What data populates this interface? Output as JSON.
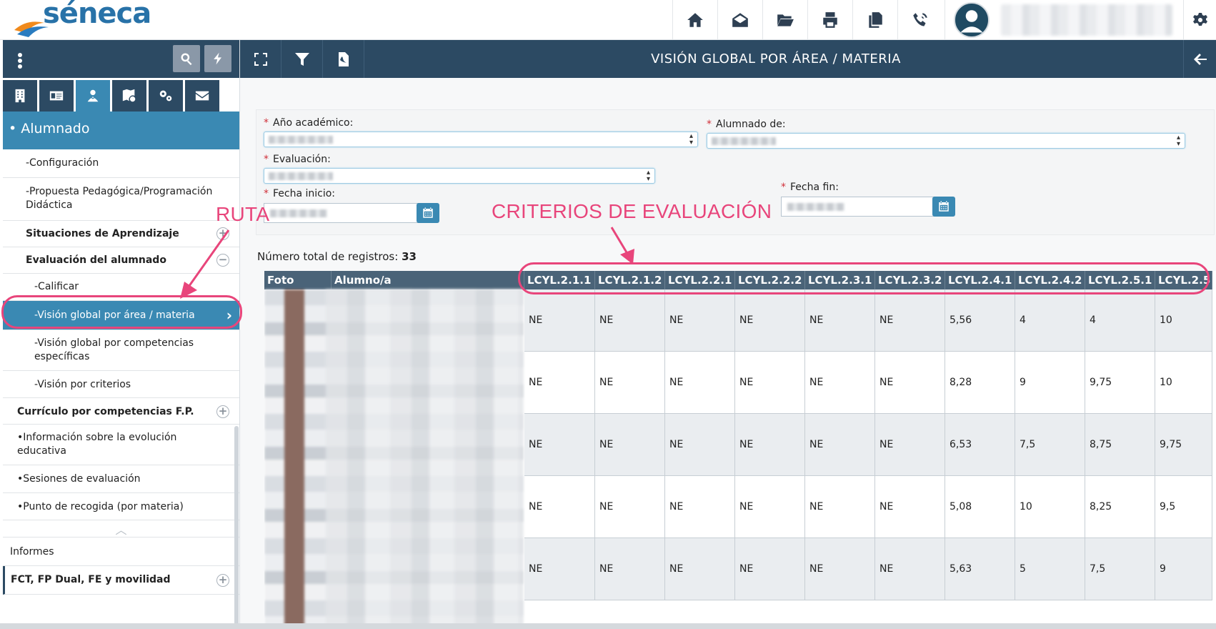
{
  "app": {
    "logo_text": "séneca"
  },
  "topbar": {
    "icons": [
      "home-icon",
      "envelope-open-icon",
      "folder-open-icon",
      "printer-icon",
      "copy-icon",
      "phone-icon"
    ],
    "settings_icon": "gear-icon"
  },
  "sidebar": {
    "section_title": "• Alumnado",
    "items": [
      {
        "label": "-Configuración",
        "bold": false
      },
      {
        "label": "-Propuesta Pedagógica/Programación Didáctica",
        "bold": false
      },
      {
        "label": "Situaciones de Aprendizaje",
        "bold": true,
        "expander": "+"
      },
      {
        "label": "Evaluación del alumnado",
        "bold": true,
        "expander": "−"
      },
      {
        "label": "-Calificar",
        "bold": false
      },
      {
        "label": "-Visión global por área / materia",
        "bold": false,
        "selected": true
      },
      {
        "label": "-Visión global por competencias específicas",
        "bold": false
      },
      {
        "label": "-Visión por criterios",
        "bold": false
      },
      {
        "label": "Currículo por competencias F.P.",
        "bold": true,
        "expander": "+"
      },
      {
        "label": "•Información sobre la evolución educativa",
        "bold": false
      },
      {
        "label": "•Sesiones de evaluación",
        "bold": false
      },
      {
        "label": "•Punto de recogida (por materia)",
        "bold": false
      },
      {
        "label": "Informes",
        "bold": false
      },
      {
        "label": "FCT, FP Dual, FE y movilidad",
        "bold": true,
        "expander": "+"
      }
    ]
  },
  "main": {
    "title": "VISIÓN GLOBAL POR ÁREA / MATERIA",
    "form": {
      "anio_label": "Año académico:",
      "alumnado_label": "Alumnado de:",
      "evaluacion_label": "Evaluación:",
      "fecha_inicio_label": "Fecha inicio:",
      "fecha_fin_label": "Fecha fin:",
      "required_mark": "*"
    },
    "total_label": "Número total de registros:",
    "total_value": "33",
    "table": {
      "headers": [
        "Foto",
        "Alumno/a",
        "LCYL.2.1.1",
        "LCYL.2.1.2",
        "LCYL.2.2.1",
        "LCYL.2.2.2",
        "LCYL.2.3.1",
        "LCYL.2.3.2",
        "LCYL.2.4.1",
        "LCYL.2.4.2",
        "LCYL.2.5.1",
        "LCYL.2.5"
      ],
      "rows": [
        [
          "NE",
          "NE",
          "NE",
          "NE",
          "NE",
          "NE",
          "5,56",
          "4",
          "4",
          "10"
        ],
        [
          "NE",
          "NE",
          "NE",
          "NE",
          "NE",
          "NE",
          "8,28",
          "9",
          "9,75",
          "10"
        ],
        [
          "NE",
          "NE",
          "NE",
          "NE",
          "NE",
          "NE",
          "6,53",
          "7,5",
          "8,75",
          "9,75"
        ],
        [
          "NE",
          "NE",
          "NE",
          "NE",
          "NE",
          "NE",
          "5,08",
          "10",
          "8,25",
          "9,5"
        ],
        [
          "NE",
          "NE",
          "NE",
          "NE",
          "NE",
          "NE",
          "5,63",
          "5",
          "7,5",
          "9"
        ]
      ]
    }
  },
  "annotations": {
    "ruta": "RUTA",
    "criterios": "CRITERIOS DE EVALUACIÓN",
    "color": "#e8457b"
  }
}
